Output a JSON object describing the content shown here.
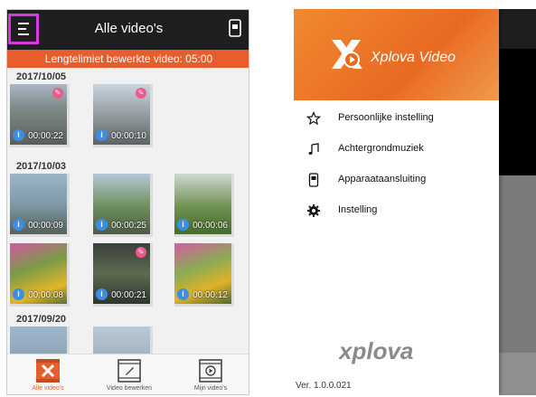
{
  "left": {
    "title": "Alle video's",
    "banner": "Lengtelimiet bewerkte video: 05:00",
    "groups": [
      {
        "date": "2017/10/05",
        "thumbs": [
          {
            "duration": "00:00:22"
          },
          {
            "duration": "00:00:10"
          }
        ]
      },
      {
        "date": "2017/10/03",
        "thumbs": [
          {
            "duration": "00:00:09"
          },
          {
            "duration": "00:00:25"
          },
          {
            "duration": "00:00:06"
          },
          {
            "duration": "00:00:08"
          },
          {
            "duration": "00:00:21"
          },
          {
            "duration": "00:00:12"
          }
        ]
      },
      {
        "date": "2017/09/20",
        "thumbs": []
      }
    ],
    "nav": [
      {
        "label": "Alle video's"
      },
      {
        "label": "Video bewerken"
      },
      {
        "label": "Mijn video's"
      }
    ],
    "colors": {
      "accent": "#e85d2d",
      "highlight": "#d53ae0",
      "info": "#3a8ee6"
    }
  },
  "right": {
    "brand": "Xplova Video",
    "menu": [
      {
        "label": "Persoonlijke instelling",
        "icon": "star-icon"
      },
      {
        "label": "Achtergrondmuziek",
        "icon": "music-note-icon"
      },
      {
        "label": "Apparaataansluiting",
        "icon": "device-icon"
      },
      {
        "label": "Instelling",
        "icon": "gear-icon"
      }
    ],
    "wordmark": "xplova",
    "version": "Ver. 1.0.0.021"
  }
}
